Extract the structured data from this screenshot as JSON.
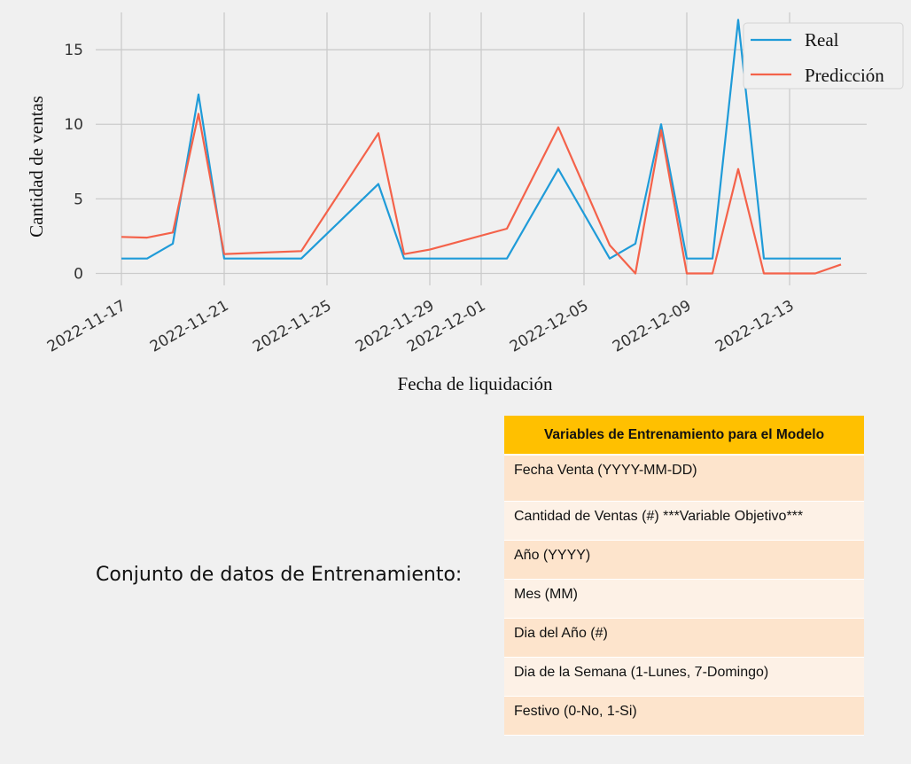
{
  "chart_data": {
    "type": "line",
    "xlabel": "Fecha de liquidación",
    "ylabel": "Cantidad de ventas",
    "ylim": [
      -0.8,
      17.5
    ],
    "yticks": [
      0,
      5,
      10,
      15
    ],
    "xticks": [
      "2022-11-17",
      "2022-11-21",
      "2022-11-25",
      "2022-11-29",
      "2022-12-01",
      "2022-12-05",
      "2022-12-09",
      "2022-12-13"
    ],
    "xlim": [
      "2022-11-16",
      "2022-12-16"
    ],
    "grid": true,
    "legend_position": "top-right",
    "series": [
      {
        "name": "Real",
        "color": "#1f9bd8",
        "points": [
          [
            "2022-11-17",
            1
          ],
          [
            "2022-11-18",
            1
          ],
          [
            "2022-11-19",
            2
          ],
          [
            "2022-11-20",
            12
          ],
          [
            "2022-11-21",
            1
          ],
          [
            "2022-11-24",
            1
          ],
          [
            "2022-11-27",
            6
          ],
          [
            "2022-11-28",
            1
          ],
          [
            "2022-12-02",
            1
          ],
          [
            "2022-12-04",
            7
          ],
          [
            "2022-12-06",
            1
          ],
          [
            "2022-12-07",
            2
          ],
          [
            "2022-12-08",
            10
          ],
          [
            "2022-12-09",
            1
          ],
          [
            "2022-12-10",
            1
          ],
          [
            "2022-12-11",
            17
          ],
          [
            "2022-12-12",
            1
          ],
          [
            "2022-12-15",
            1
          ]
        ]
      },
      {
        "name": "Predicción",
        "color": "#f4624a",
        "points": [
          [
            "2022-11-17",
            2.45
          ],
          [
            "2022-11-18",
            2.4
          ],
          [
            "2022-11-19",
            2.75
          ],
          [
            "2022-11-20",
            10.7
          ],
          [
            "2022-11-21",
            1.3
          ],
          [
            "2022-11-24",
            1.5
          ],
          [
            "2022-11-27",
            9.4
          ],
          [
            "2022-11-28",
            1.3
          ],
          [
            "2022-11-29",
            1.6
          ],
          [
            "2022-12-02",
            3.0
          ],
          [
            "2022-12-04",
            9.8
          ],
          [
            "2022-12-06",
            1.9
          ],
          [
            "2022-12-07",
            0
          ],
          [
            "2022-12-08",
            9.6
          ],
          [
            "2022-12-09",
            0
          ],
          [
            "2022-12-10",
            0
          ],
          [
            "2022-12-11",
            7
          ],
          [
            "2022-12-12",
            0
          ],
          [
            "2022-12-14",
            0
          ],
          [
            "2022-12-15",
            0.6
          ]
        ]
      }
    ]
  },
  "dataset_caption": "Conjunto de datos de Entrenamiento:",
  "variables_table": {
    "header": "Variables de Entrenamiento para el Modelo",
    "rows": [
      "Fecha Venta (YYYY-MM-DD)",
      "Cantidad de Ventas (#)  ***Variable Objetivo***",
      "Año (YYYY)",
      "Mes (MM)",
      "Dia del Año (#)",
      "Dia de la Semana (1-Lunes, 7-Domingo)",
      "Festivo (0-No, 1-Si)"
    ]
  }
}
